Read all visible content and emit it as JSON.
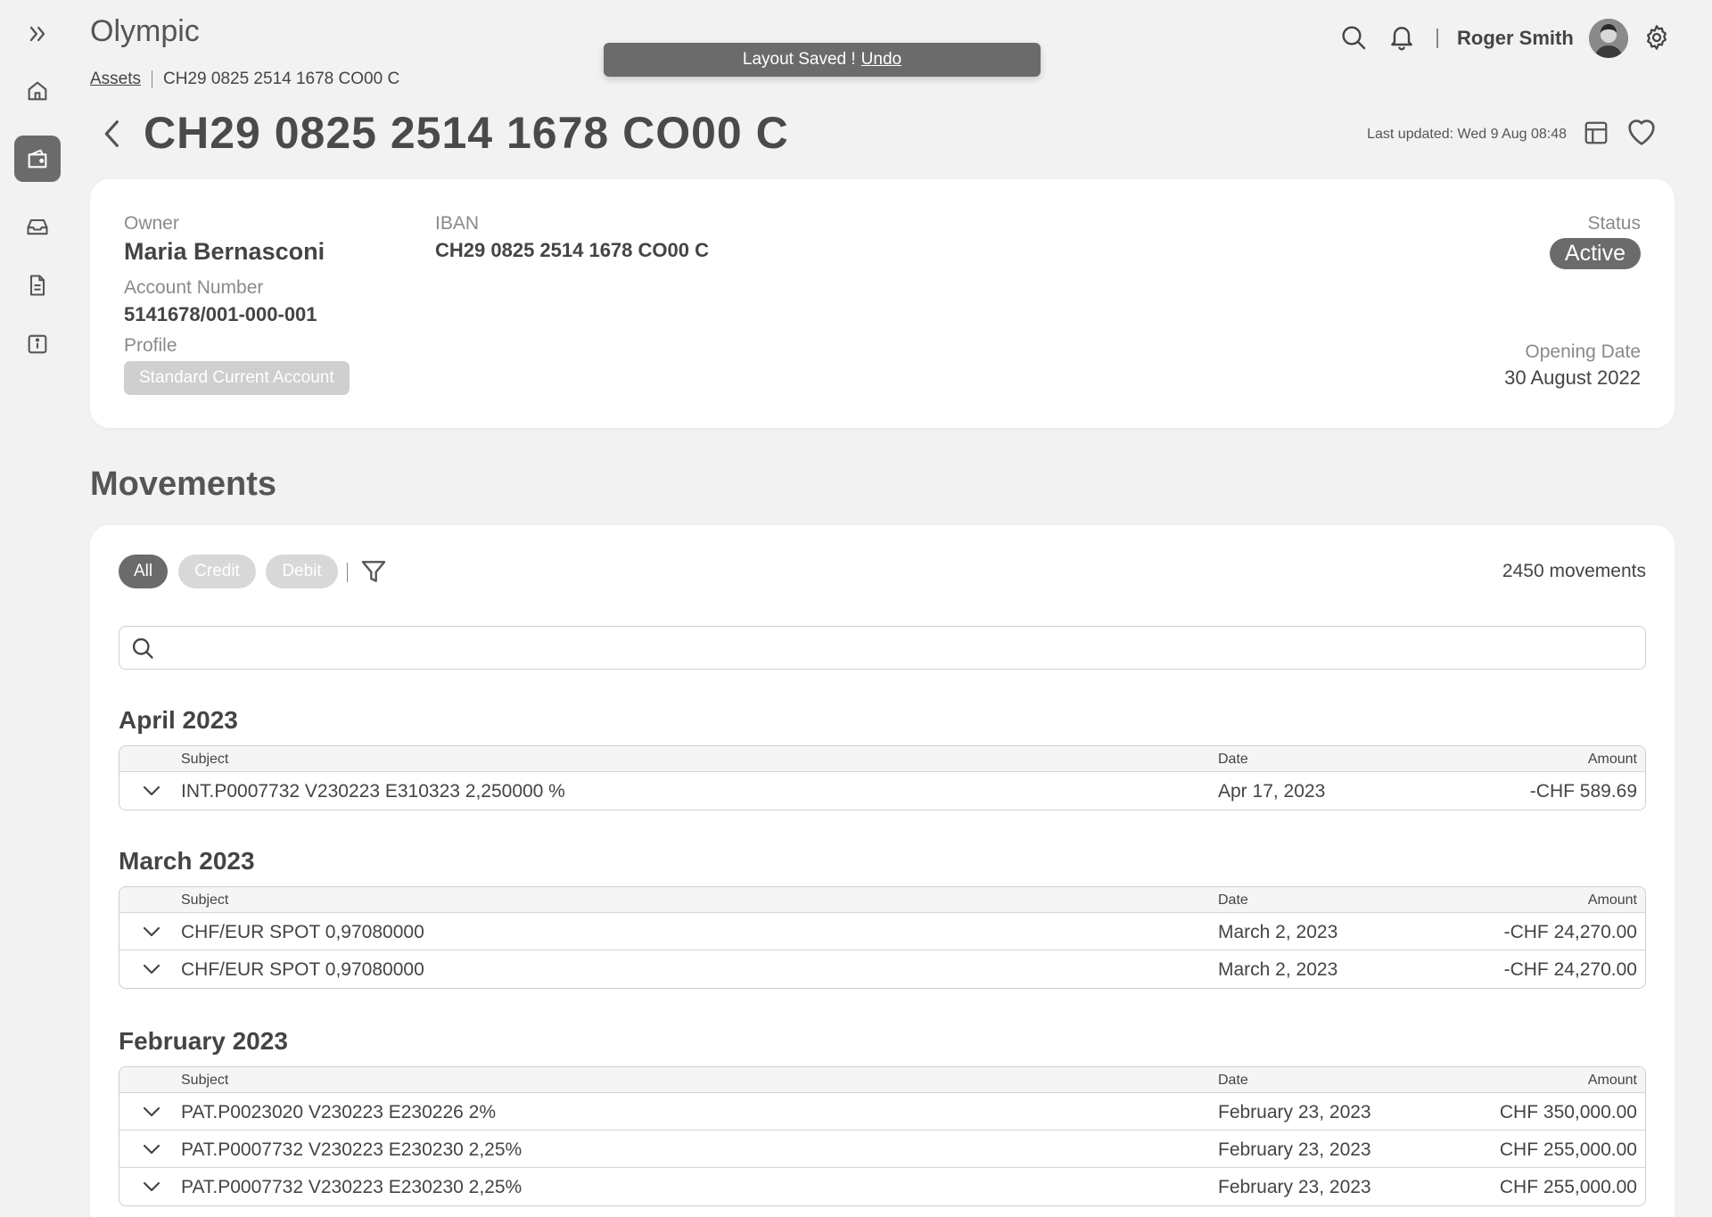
{
  "app": {
    "title": "Olympic"
  },
  "sidebar": {
    "items": [
      {
        "name": "expand",
        "icon": "chevrons-right-icon"
      },
      {
        "name": "home",
        "icon": "home-icon"
      },
      {
        "name": "wallet",
        "icon": "wallet-icon",
        "active": true
      },
      {
        "name": "inbox",
        "icon": "inbox-icon"
      },
      {
        "name": "documents",
        "icon": "document-icon"
      },
      {
        "name": "info",
        "icon": "info-icon"
      }
    ]
  },
  "breadcrumb": {
    "parent": "Assets",
    "current": "CH29 0825 2514 1678 CO00 C"
  },
  "toast": {
    "message": "Layout Saved !",
    "action": "Undo"
  },
  "header": {
    "user_name": "Roger Smith"
  },
  "page": {
    "title": "CH29 0825 2514 1678 CO00 C",
    "last_updated": "Last updated: Wed 9 Aug 08:48"
  },
  "account": {
    "owner_label": "Owner",
    "owner": "Maria Bernasconi",
    "account_number_label": "Account Number",
    "account_number": "5141678/001-000-001",
    "profile_label": "Profile",
    "profile": "Standard Current Account",
    "iban_label": "IBAN",
    "iban": "CH29 0825 2514 1678 CO00 C",
    "status_label": "Status",
    "status": "Active",
    "opening_date_label": "Opening Date",
    "opening_date": "30 August 2022"
  },
  "movements": {
    "title": "Movements",
    "filters": [
      "All",
      "Credit",
      "Debit"
    ],
    "count": "2450 movements",
    "search_placeholder": "",
    "columns": {
      "subject": "Subject",
      "date": "Date",
      "amount": "Amount"
    },
    "groups": [
      {
        "month": "April 2023",
        "rows": [
          {
            "subject": "INT.P0007732 V230223 E310323 2,250000 %",
            "date": "Apr 17, 2023",
            "amount": "-CHF 589.69"
          }
        ]
      },
      {
        "month": "March 2023",
        "rows": [
          {
            "subject": "CHF/EUR SPOT 0,97080000",
            "date": "March 2, 2023",
            "amount": "-CHF 24,270.00"
          },
          {
            "subject": "CHF/EUR SPOT 0,97080000",
            "date": "March 2, 2023",
            "amount": "-CHF 24,270.00"
          }
        ]
      },
      {
        "month": "February 2023",
        "rows": [
          {
            "subject": "PAT.P0023020 V230223 E230226 2%",
            "date": "February 23, 2023",
            "amount": "CHF 350,000.00"
          },
          {
            "subject": "PAT.P0007732 V230223 E230230 2,25%",
            "date": "February 23, 2023",
            "amount": "CHF 255,000.00"
          },
          {
            "subject": "PAT.P0007732 V230223 E230230 2,25%",
            "date": "February 23, 2023",
            "amount": "CHF 255,000.00"
          }
        ]
      }
    ]
  }
}
